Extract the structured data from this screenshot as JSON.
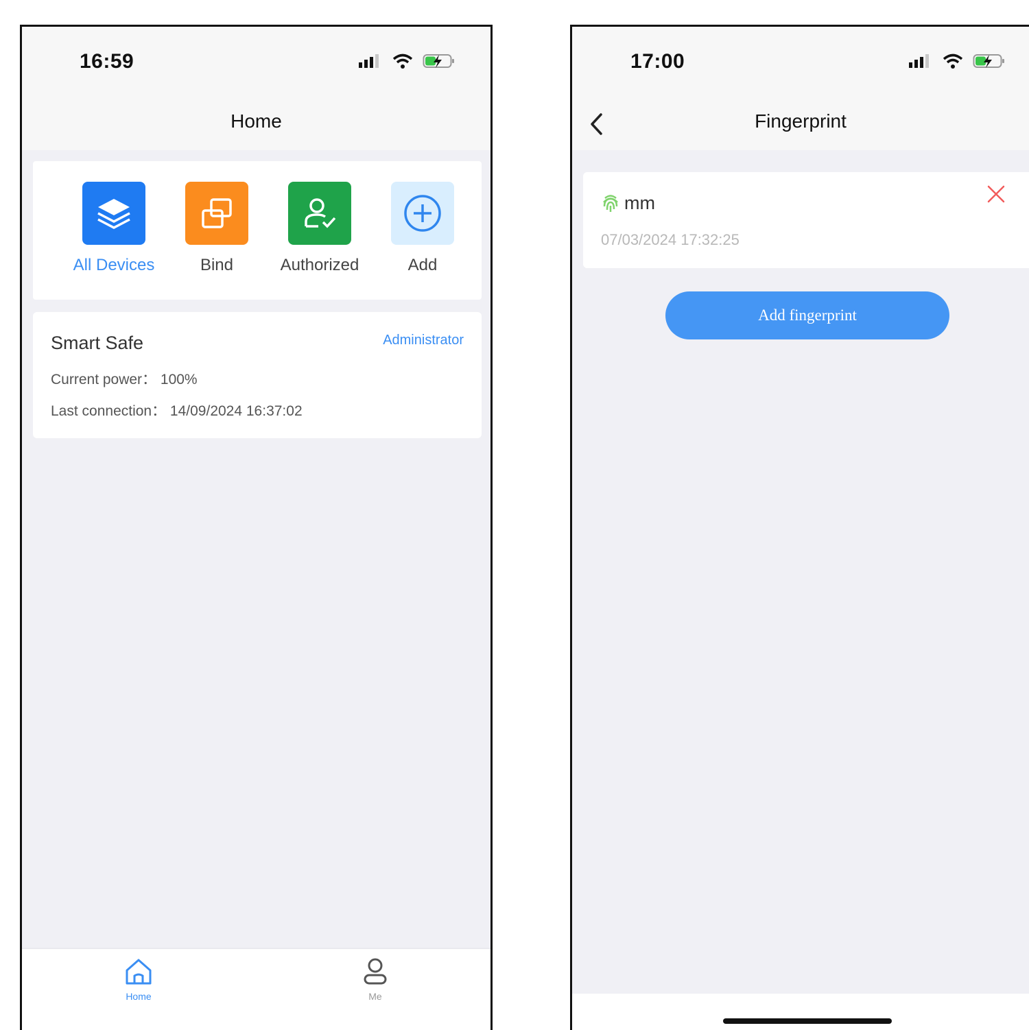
{
  "left_screen": {
    "status": {
      "time": "16:59"
    },
    "title": "Home",
    "quick_actions": [
      {
        "label": "All Devices",
        "icon": "layers-icon",
        "color": "#1f7bf2",
        "active": true
      },
      {
        "label": "Bind",
        "icon": "copy-squares-icon",
        "color": "#fb8c1e",
        "active": false
      },
      {
        "label": "Authorized",
        "icon": "user-check-icon",
        "color": "#1fa34a",
        "active": false
      },
      {
        "label": "Add",
        "icon": "plus-circle-icon",
        "color": "#d9eefe",
        "active": false
      }
    ],
    "device": {
      "name": "Smart Safe",
      "role": "Administrator",
      "power_line": "Current power：  100%",
      "connection_line": "Last connection：  14/09/2024 16:37:02"
    },
    "tabs": [
      {
        "label": "Home",
        "icon": "home-icon",
        "active": true
      },
      {
        "label": "Me",
        "icon": "person-icon",
        "active": false
      }
    ]
  },
  "right_screen": {
    "status": {
      "time": "17:00"
    },
    "title": "Fingerprint",
    "fingerprint": {
      "name": "mm",
      "date": "07/03/2024 17:32:25",
      "icon": "fingerprint-icon"
    },
    "add_button_label": "Add fingerprint"
  },
  "colors": {
    "accent": "#3a8ef3",
    "button_blue": "#4596f4",
    "delete_red": "#f25c5c",
    "fingerprint_green": "#7fd36c"
  }
}
